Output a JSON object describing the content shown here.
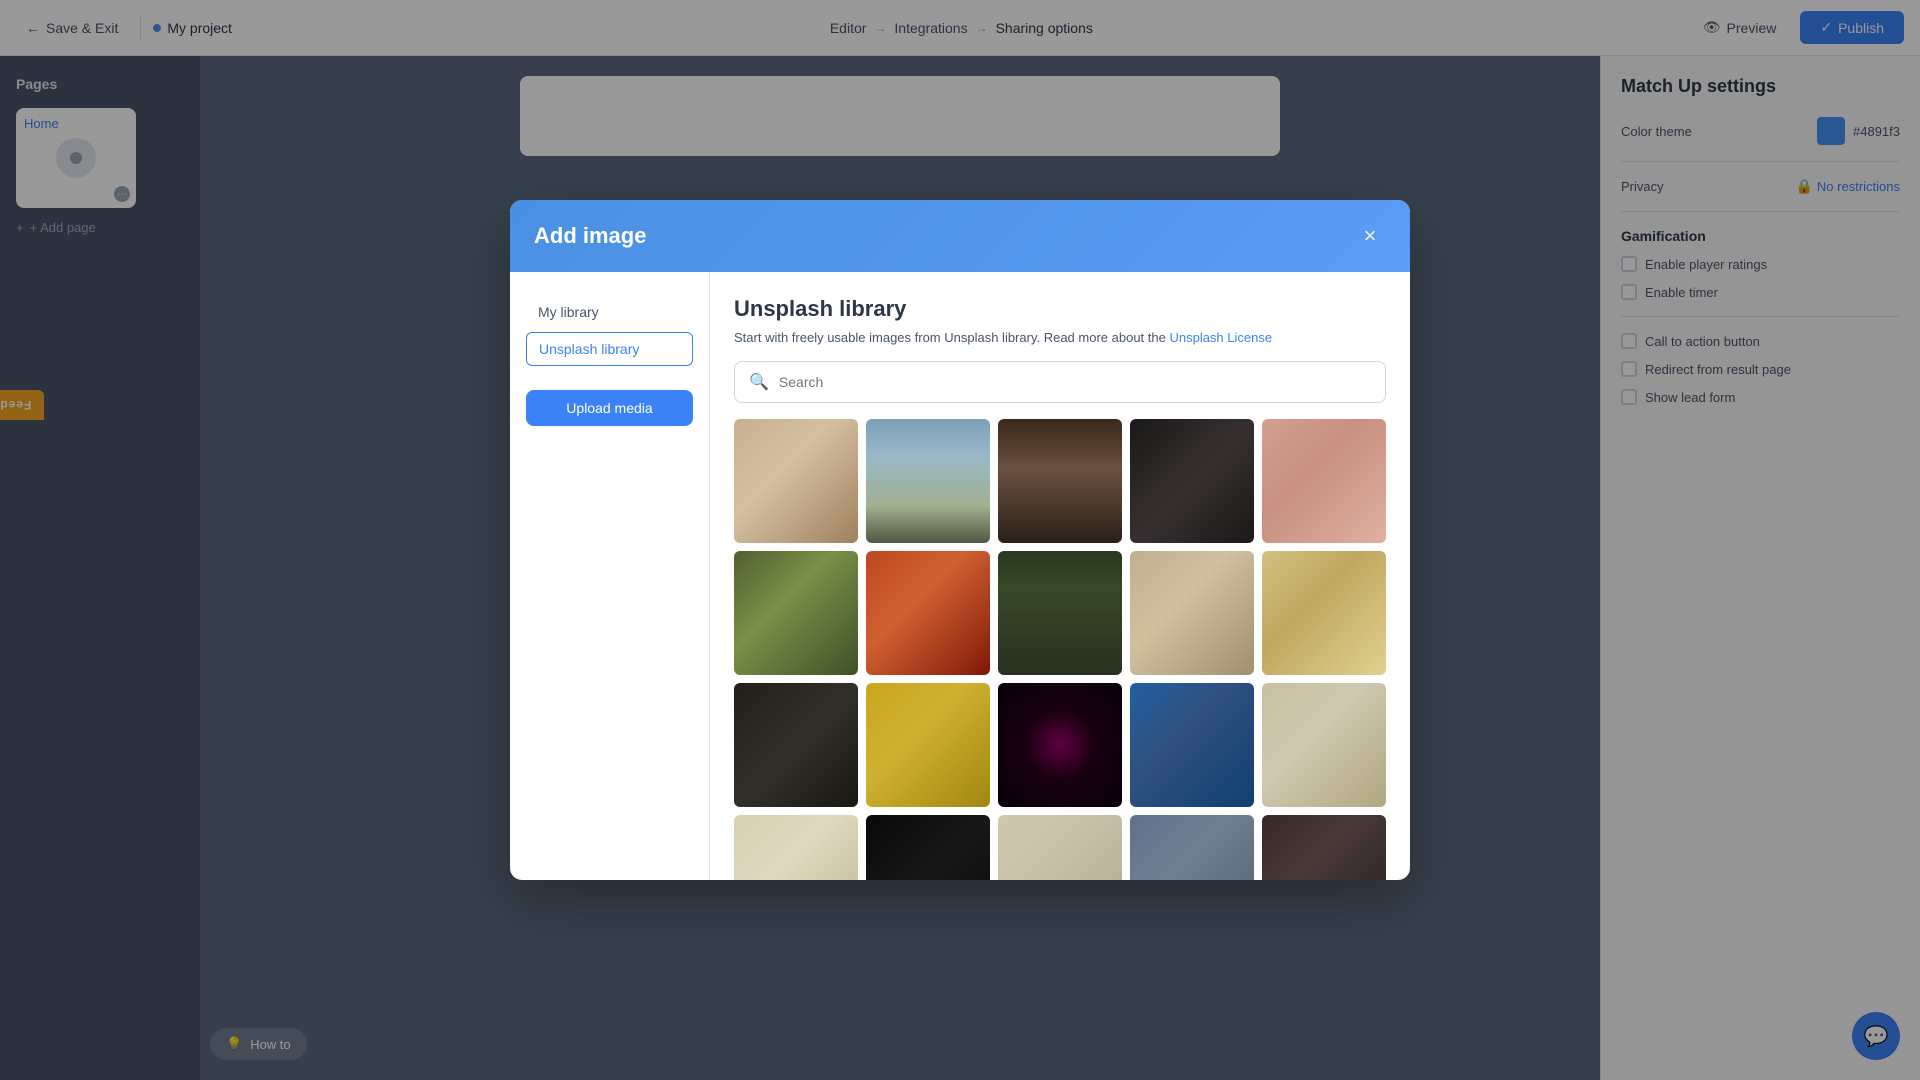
{
  "topbar": {
    "save_exit_label": "Save & Exit",
    "project_name": "My project",
    "editor_label": "Editor",
    "integrations_label": "Integrations",
    "sharing_options_label": "Sharing options",
    "preview_label": "Preview",
    "publish_label": "Publish"
  },
  "left_sidebar": {
    "pages_title": "Pages",
    "home_label": "Home",
    "add_page_label": "+ Add page"
  },
  "right_sidebar": {
    "settings_title": "Match Up settings",
    "color_theme_label": "Color theme",
    "color_value": "#4891f3",
    "privacy_label": "Privacy",
    "no_restrictions_label": "No restrictions",
    "gamification_title": "Gamification",
    "enable_player_ratings_label": "Enable player ratings",
    "enable_timer_label": "Enable timer",
    "call_to_action_label": "Call to action button",
    "redirect_label": "Redirect from result page",
    "show_lead_form_label": "Show lead form"
  },
  "feedback_tab": {
    "label": "Feedback"
  },
  "how_to": {
    "label": "How to"
  },
  "modal": {
    "title": "Add image",
    "close_label": "×",
    "my_library_label": "My library",
    "unsplash_library_label": "Unsplash library",
    "upload_media_label": "Upload media",
    "unsplash_title": "Unsplash library",
    "unsplash_desc": "Start with freely usable images from Unsplash library. Read more about the",
    "unsplash_link_label": "Unsplash License",
    "search_placeholder": "Search",
    "images": [
      {
        "id": 1,
        "bg": "#c8b8a2",
        "type": "food"
      },
      {
        "id": 2,
        "bg": "#7a9cb0",
        "type": "mountain"
      },
      {
        "id": 3,
        "bg": "#4a3828",
        "type": "door"
      },
      {
        "id": 4,
        "bg": "#2a2a2a",
        "type": "camera"
      },
      {
        "id": 5,
        "bg": "#d4a090",
        "type": "skin"
      },
      {
        "id": 6,
        "bg": "#6a8040",
        "type": "people"
      },
      {
        "id": 7,
        "bg": "#c05020",
        "type": "sunset"
      },
      {
        "id": 8,
        "bg": "#3a5030",
        "type": "road"
      },
      {
        "id": 9,
        "bg": "#b0a080",
        "type": "building"
      },
      {
        "id": 10,
        "bg": "#d4b870",
        "type": "plate"
      },
      {
        "id": 11,
        "bg": "#2a2a20",
        "type": "overhead"
      },
      {
        "id": 12,
        "bg": "#c8a020",
        "type": "flowers"
      },
      {
        "id": 13,
        "bg": "#1a0818",
        "type": "abstract"
      },
      {
        "id": 14,
        "bg": "#2060a0",
        "type": "bird"
      },
      {
        "id": 15,
        "bg": "#c8c0a0",
        "type": "keyboard"
      },
      {
        "id": 16,
        "bg": "#d8d0b0",
        "type": "tea"
      },
      {
        "id": 17,
        "bg": "#101010",
        "type": "dark"
      },
      {
        "id": 18,
        "bg": "#d0c8b0",
        "type": "hands"
      },
      {
        "id": 19,
        "bg": "#6070a0",
        "type": "building2"
      },
      {
        "id": 20,
        "bg": "#3a2828",
        "type": "portrait"
      }
    ]
  }
}
